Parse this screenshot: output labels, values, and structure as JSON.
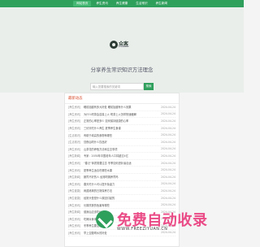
{
  "nav": {
    "items": [
      {
        "label": "网站首页"
      },
      {
        "label": "养生资讯"
      },
      {
        "label": "养生健康"
      },
      {
        "label": "生活常识"
      },
      {
        "label": "养生新闻"
      }
    ]
  },
  "hero": {
    "logo_text": "众客",
    "logo_sub": "ZHONGKE",
    "slogan": "分享养生常识知识方法理念",
    "search_placeholder": "输入您要搜索的关键词",
    "search_button": "搜索"
  },
  "latest": {
    "title": "最新动态",
    "items": [
      {
        "category": "[养生资讯]",
        "title": "睡前抬腿有多大好处 睡前抬腿有什么效果",
        "date": "2024-04-24"
      },
      {
        "category": "[养生资讯]",
        "title": "为什么喝茶会容易上火 喝茶上火怎样快速缓解",
        "date": "2024-04-24"
      },
      {
        "category": "[养生资讯]",
        "title": "正常的心率是多少 如何保持健康的心率",
        "date": "2024-04-24"
      },
      {
        "category": "[养生资讯]",
        "title": "三伏天吃什么养生 夏季养生食谱",
        "date": "2024-04-24"
      },
      {
        "category": "[生活常识]",
        "title": "有助于增高的食物有哪些",
        "date": "2024-04-24"
      },
      {
        "category": "[生活常识]",
        "title": "熬夜后喝什么饮品好",
        "date": "2024-04-24"
      },
      {
        "category": "[养生资讯]",
        "title": "山茶花的养殖方法和注意事项",
        "date": "2024-04-24"
      },
      {
        "category": "[养生新闻]",
        "title": "专家：2030年中国老年人口将超过4亿",
        "date": "2024-04-24"
      },
      {
        "category": "[养生资讯]",
        "title": "“春泛”体质需要注意 冬季如何进补最合适",
        "date": "2024-04-24"
      },
      {
        "category": "[养生资讯]",
        "title": "夏季养生适合吃哪些水果",
        "date": "2024-04-24"
      },
      {
        "category": "[养生新闻]",
        "title": "肠胃不好的人 经常喝粥养胃吗",
        "date": "2024-04-24"
      },
      {
        "category": "[养生资讯]",
        "title": "春天吃什么可以提升免疫力",
        "date": "2024-04-24"
      },
      {
        "category": "[养生健康]",
        "title": "肩颈疼痛的日常保养方法",
        "date": "2024-04-24"
      },
      {
        "category": "[养生健康]",
        "title": "经常头晕是什么原因引起的",
        "date": "2024-04-24"
      },
      {
        "category": "[养生资讯]",
        "title": "长期熬夜的危害有哪些",
        "date": "2024-04-24"
      },
      {
        "category": "[养生新闻]",
        "title": "健身后应该吃什么",
        "date": "2024-04-24"
      },
      {
        "category": "[养生资讯]",
        "title": "吃辣对身体有什么好处",
        "date": "2024-04-24"
      },
      {
        "category": "[养生资讯]",
        "title": "冬季养生要注意什么",
        "date": "2024-04-24"
      },
      {
        "category": "[养生资讯]",
        "title": "早上空腹喝水的好处",
        "date": "2024-04-24"
      }
    ]
  },
  "watermark": {
    "text": "免费自动收录",
    "url": "WWW.FREEZIYUAN.CN"
  }
}
